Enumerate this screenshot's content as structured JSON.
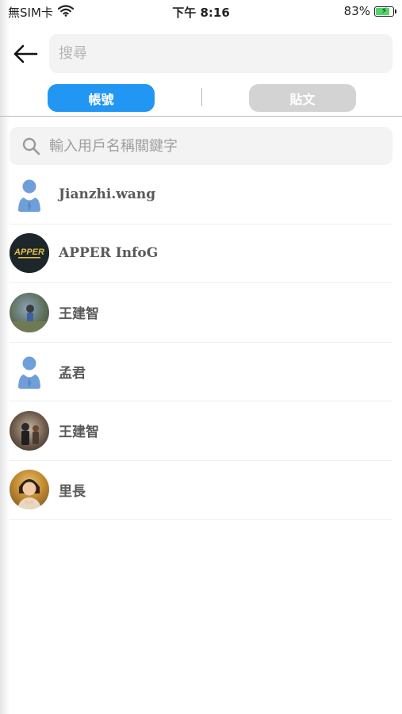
{
  "status_bar": {
    "carrier": "無SIM卡",
    "time": "下午 8:16",
    "battery_percent": "83%",
    "battery_level": 0.83,
    "charging": true,
    "wifi_icon": "wifi-icon"
  },
  "header": {
    "back_icon": "arrow-left-icon",
    "search_placeholder": "搜尋"
  },
  "tabs": [
    {
      "label": "帳號",
      "active": true,
      "color": "#2196f3"
    },
    {
      "label": "貼文",
      "active": false,
      "color": "#d3d3d3"
    }
  ],
  "filter": {
    "icon": "search-icon",
    "placeholder": "輸入用戶名稱關鍵字"
  },
  "users": [
    {
      "name": "Jianzhi.wang",
      "avatar": "default-avatar"
    },
    {
      "name": "APPER InfoG",
      "avatar": "logo-avatar",
      "logo_text": "APPER"
    },
    {
      "name": "王建智",
      "avatar": "photo-avatar"
    },
    {
      "name": "孟君",
      "avatar": "default-avatar"
    },
    {
      "name": "王建智",
      "avatar": "photo-avatar"
    },
    {
      "name": "里長",
      "avatar": "photo-avatar"
    }
  ],
  "colors": {
    "accent": "#2196f3",
    "default_avatar": "#6f9fd8"
  }
}
